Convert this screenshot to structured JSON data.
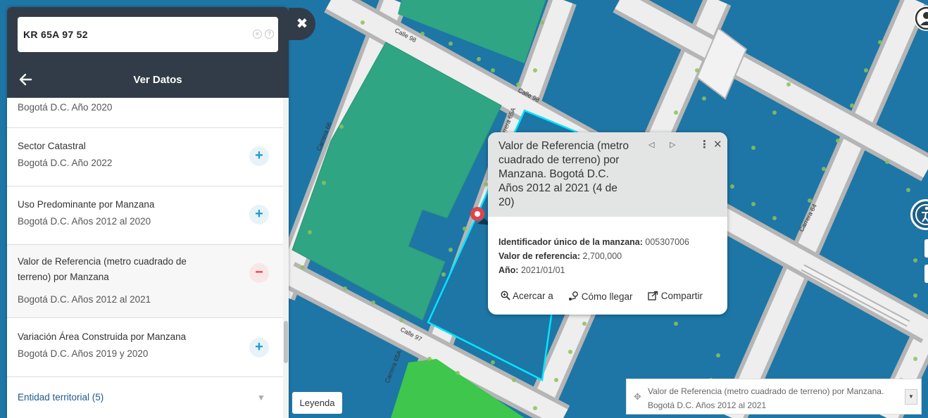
{
  "search": {
    "value": "KR 65A 97 52"
  },
  "panel": {
    "title": "Ver Datos",
    "items": [
      {
        "title": "",
        "subtitle": "Bogotá D.C. Año 2020",
        "state": ""
      },
      {
        "title": "Sector Catastral",
        "subtitle": "Bogotá D.C. Año 2022",
        "state": "+"
      },
      {
        "title": "Uso Predominante por Manzana",
        "subtitle": "Bogotá D.C. Años 2012 al 2020",
        "state": "+"
      },
      {
        "title": "Valor de Referencia (metro cuadrado de terreno) por Manzana",
        "subtitle": "Bogotá D.C. Años 2012 al 2021",
        "state": "−"
      },
      {
        "title": "Variación Área Construida por Manzana",
        "subtitle": "Bogotá D.C. Años 2019 y 2020",
        "state": "+"
      }
    ],
    "group": {
      "label": "Entidad territorial (5)",
      "toggle": "▼"
    }
  },
  "popup": {
    "title": "Valor de Referencia (metro cuadrado de terreno) por Manzana. Bogotá D.C. Años 2012 al 2021 (4 de 20)",
    "fields": [
      {
        "label": "Identificador único de la manzana:",
        "value": "005307006"
      },
      {
        "label": "Valor de referencia:",
        "value": "2,700,000"
      },
      {
        "label": "Año:",
        "value": "2021/01/01"
      }
    ],
    "actions": {
      "zoom": "Acercar a",
      "directions": "Cómo llegar",
      "share": "Compartir"
    }
  },
  "legend_button": "Leyenda",
  "layer_select": "Valor de Referencia (metro cuadrado de terreno) por Manzana. Bogotá D.C. Años 2012 al 2021",
  "street_labels": {
    "calle98_top": "Calle 98",
    "calle98": "Calle 98",
    "carrera66": "Carrera 66",
    "carrera65a": "Carrera 65A",
    "calle97": "Calle 97",
    "carrera65a_bottom": "Carrera 65A",
    "carrera64": "Carrera 64"
  },
  "colors": {
    "map_background": "#1d76a6",
    "block_green": "#2fa583",
    "park_green": "#3ec64d",
    "road": "#e9e9e9",
    "highlight": "#00e5ff",
    "header": "#323c48"
  },
  "icons": {
    "back": "arrow-left-icon",
    "close_panel": "close-icon",
    "prev": "triangle-left-icon",
    "next": "triangle-right-icon",
    "more": "more-vertical-icon",
    "close": "close-icon",
    "zoom": "zoom-in-icon",
    "directions": "directions-icon",
    "share": "share-icon",
    "legend_drag": "move-icon",
    "user": "user-icon",
    "accessibility": "accessibility-icon"
  }
}
